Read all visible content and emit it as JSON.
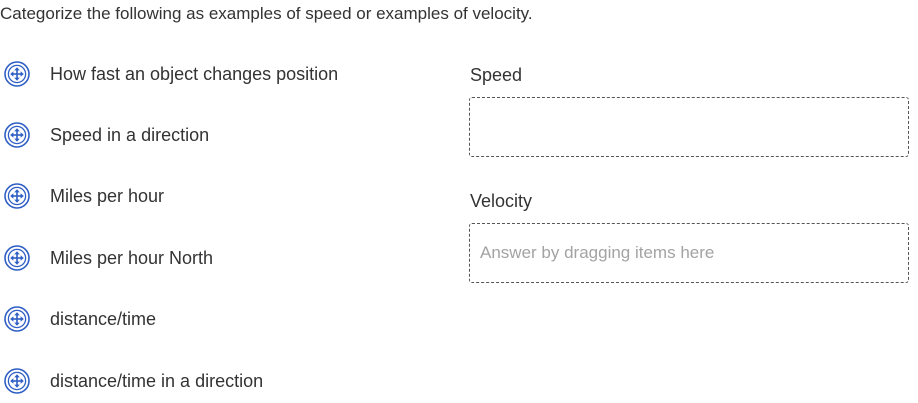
{
  "question": "Categorize the following as examples of speed or examples of velocity.",
  "items": [
    {
      "label": "How fast an object changes position",
      "icon": "move-drag-icon"
    },
    {
      "label": "Speed in a direction",
      "icon": "move-drag-icon"
    },
    {
      "label": "Miles per hour",
      "icon": "move-drag-icon"
    },
    {
      "label": "Miles per hour North",
      "icon": "move-drag-icon"
    },
    {
      "label": "distance/time",
      "icon": "move-drag-icon"
    },
    {
      "label": "distance/time in a direction",
      "icon": "move-drag-icon"
    }
  ],
  "categories": [
    {
      "label": "Speed",
      "placeholder": ""
    },
    {
      "label": "Velocity",
      "placeholder": "Answer by dragging items here"
    }
  ],
  "colors": {
    "icon_blue": "#2f5fc4",
    "text": "#333333",
    "placeholder": "#a3a3a3",
    "dropzone_border": "#555555"
  }
}
